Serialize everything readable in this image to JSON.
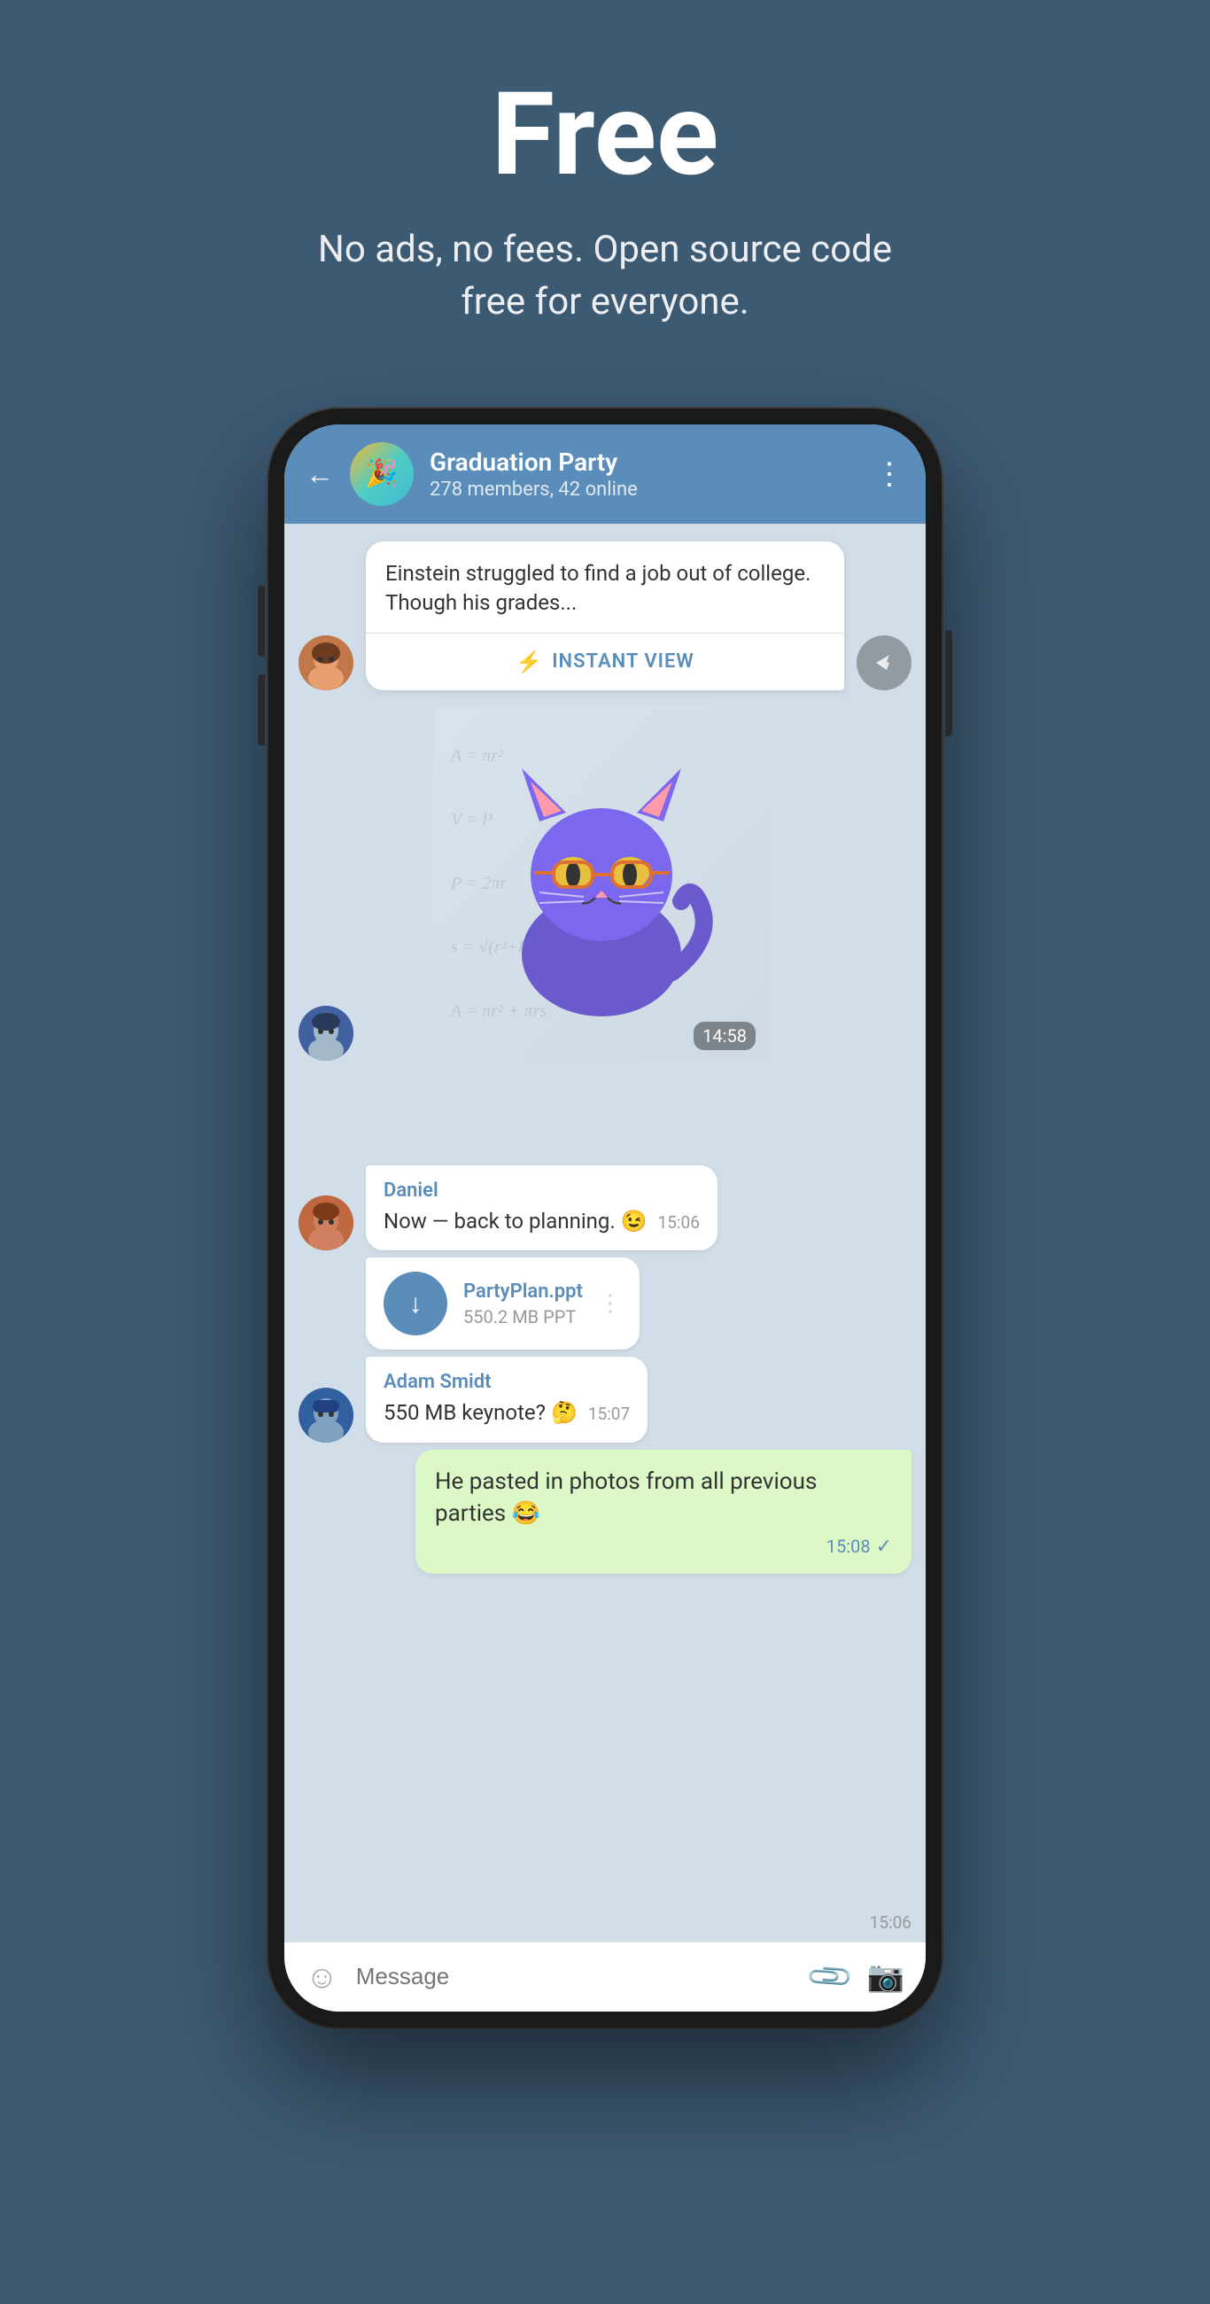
{
  "hero": {
    "title": "Free",
    "subtitle": "No ads, no fees. Open source code free for everyone."
  },
  "chat": {
    "group_name": "Graduation Party",
    "group_info": "278 members, 42 online",
    "back_label": "←",
    "menu_label": "⋮",
    "article_text": "Einstein struggled to find a job out of college. Though his grades...",
    "instant_view_label": "INSTANT VIEW",
    "sticker_time": "14:58",
    "messages": [
      {
        "sender": "Daniel",
        "text": "Now — back to planning. 😉",
        "time": "15:06",
        "type": "received"
      },
      {
        "sender": "",
        "file_name": "PartyPlan.ppt",
        "file_size": "550.2 MB PPT",
        "time": "15:06",
        "type": "file"
      },
      {
        "sender": "Adam Smidt",
        "text": "550 MB keynote? 🤔",
        "time": "15:07",
        "type": "received"
      },
      {
        "sender": "",
        "text": "He pasted in photos from all previous parties 😂",
        "time": "15:08",
        "type": "sent",
        "check": "✓"
      }
    ],
    "input_placeholder": "Message"
  }
}
